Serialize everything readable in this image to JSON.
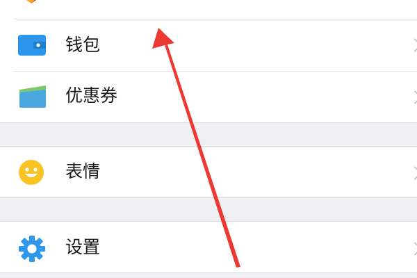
{
  "menu": {
    "items": [
      {
        "label": "钱包",
        "icon": "wallet-icon"
      },
      {
        "label": "优惠券",
        "icon": "coupon-icon"
      },
      {
        "label": "表情",
        "icon": "emoji-icon"
      },
      {
        "label": "设置",
        "icon": "gear-icon"
      }
    ]
  },
  "annotation": {
    "icon": "red-arrow-icon"
  },
  "colors": {
    "wallet_blue": "#2b96ec",
    "coupon_blue": "#4aa7e0",
    "coupon_green": "#7ec76d",
    "emoji_yellow": "#f8c324",
    "gear_blue": "#2f98ea",
    "arrow_red": "#ec3a32",
    "background_gray": "#efeff4"
  }
}
